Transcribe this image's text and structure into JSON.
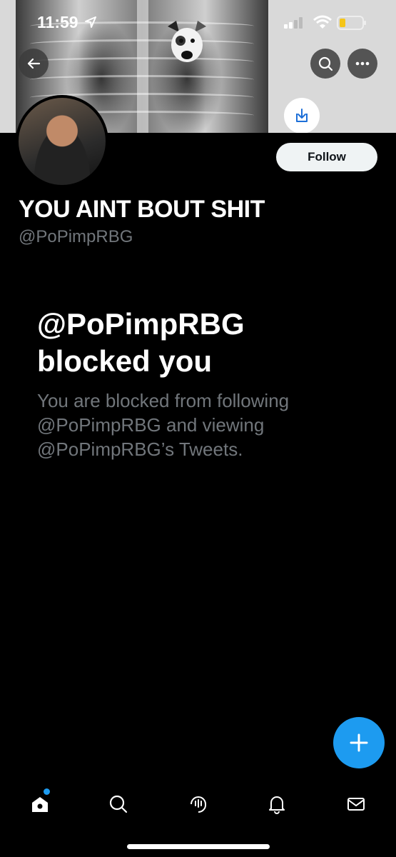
{
  "status_bar": {
    "time": "11:59"
  },
  "profile": {
    "display_name": "YOU AINT BOUT SHIT",
    "handle": "@PoPimpRBG",
    "follow_label": "Follow"
  },
  "blocked": {
    "title_line1": "@PoPimpRBG",
    "title_line2": "blocked you",
    "description": "You are blocked from following @PoPimpRBG and viewing @PoPimpRBG’s Tweets."
  },
  "colors": {
    "accent": "#1d9bf0",
    "secondary_text": "#71767b",
    "background": "#000000"
  },
  "icons": [
    "back-arrow-icon",
    "search-icon",
    "more-icon",
    "download-icon",
    "compose-icon",
    "home-icon",
    "explore-icon",
    "spaces-icon",
    "notifications-icon",
    "messages-icon"
  ]
}
